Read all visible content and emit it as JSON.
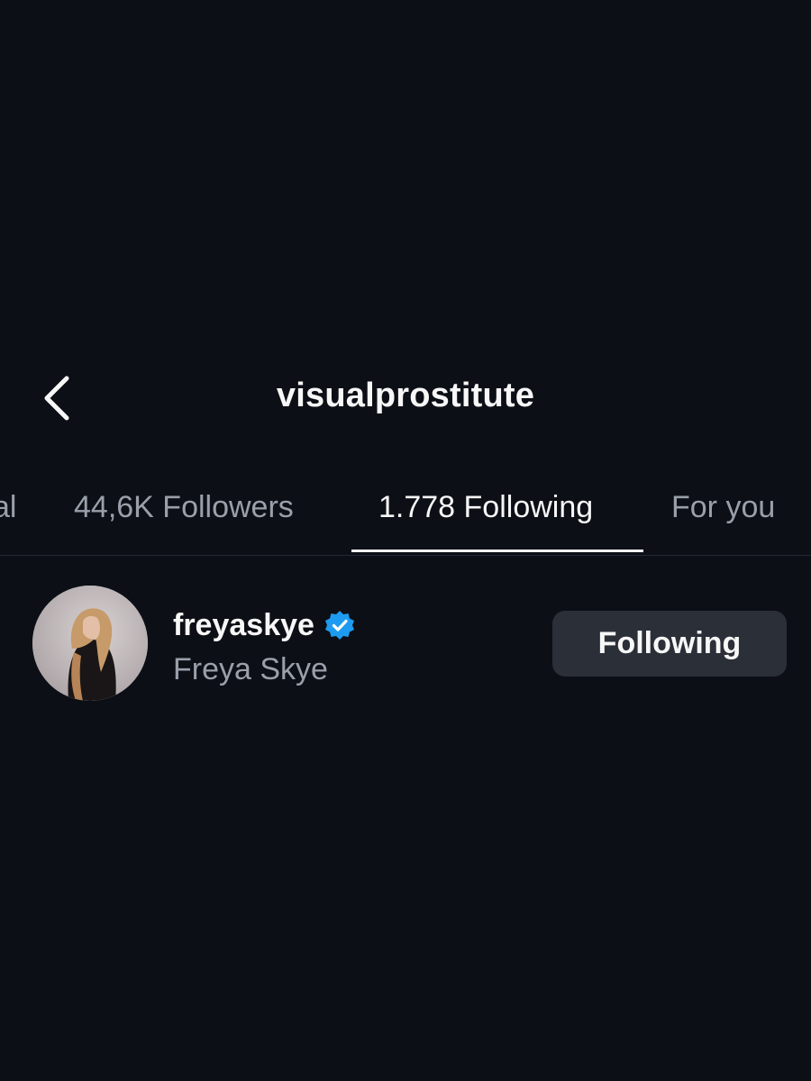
{
  "header": {
    "title": "visualprostitute",
    "back_icon": "chevron-left-icon"
  },
  "tabs": [
    {
      "label": "al",
      "active": false
    },
    {
      "label": "44,6K Followers",
      "active": false
    },
    {
      "label": "1.778 Following",
      "active": true
    },
    {
      "label": "For you",
      "active": false
    }
  ],
  "list": [
    {
      "username": "freyaskye",
      "full_name": "Freya Skye",
      "verified": true,
      "verified_icon": "verified-badge-icon",
      "button_label": "Following"
    }
  ],
  "colors": {
    "background": "#0c0f16",
    "text_primary": "#f7f7f7",
    "text_secondary": "#9aa0aa",
    "verified_blue": "#1d9bf0",
    "button_bg": "#2a2f38"
  }
}
